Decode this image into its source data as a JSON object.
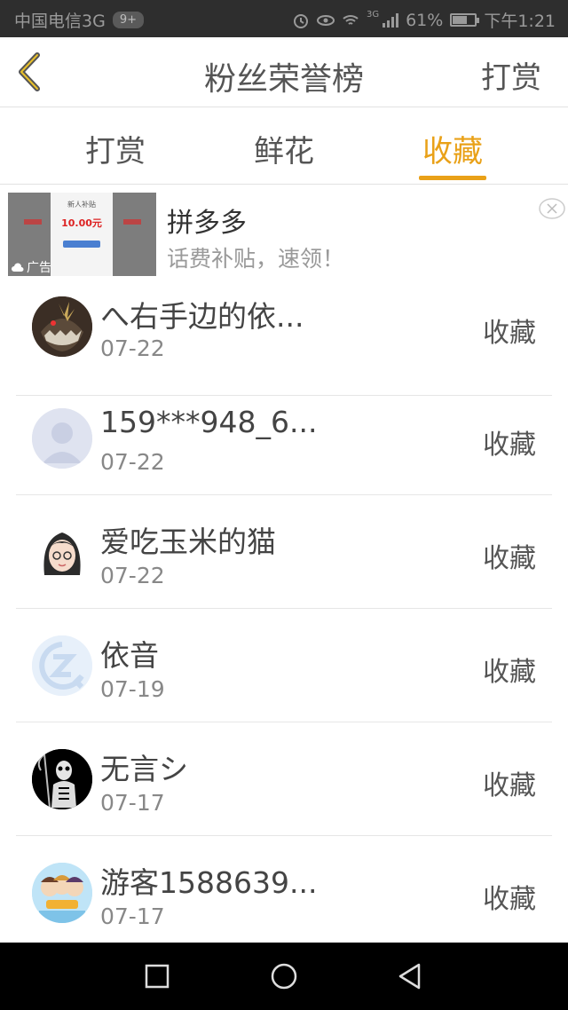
{
  "status_bar": {
    "carrier": "中国电信3G",
    "badge": "9+",
    "network_label": "3G",
    "battery_percent": "61%",
    "battery_level": 0.61,
    "time": "下午1:21"
  },
  "header": {
    "title": "粉丝荣誉榜",
    "action": "打赏"
  },
  "tabs": [
    {
      "label": "打赏",
      "active": false
    },
    {
      "label": "鲜花",
      "active": false
    },
    {
      "label": "收藏",
      "active": true
    }
  ],
  "ad": {
    "name": "拼多多",
    "description": "话费补贴，速领！",
    "thumb_price": "10.00元",
    "badge": "广告"
  },
  "fans": [
    {
      "name": "へ右手边的依...",
      "date": "07-22",
      "action": "收藏"
    },
    {
      "name": "159***948_6...",
      "date": "07-22",
      "action": "收藏"
    },
    {
      "name": "爱吃玉米的猫",
      "date": "07-22",
      "action": "收藏"
    },
    {
      "name": "依音",
      "date": "07-19",
      "action": "收藏"
    },
    {
      "name": "无言シ",
      "date": "07-17",
      "action": "收藏"
    },
    {
      "name": "游客1588639...",
      "date": "07-17",
      "action": "收藏"
    }
  ],
  "colors": {
    "accent": "#e9a118",
    "status_bar_bg": "#2e2e2e",
    "system_nav_bg": "#000000"
  }
}
